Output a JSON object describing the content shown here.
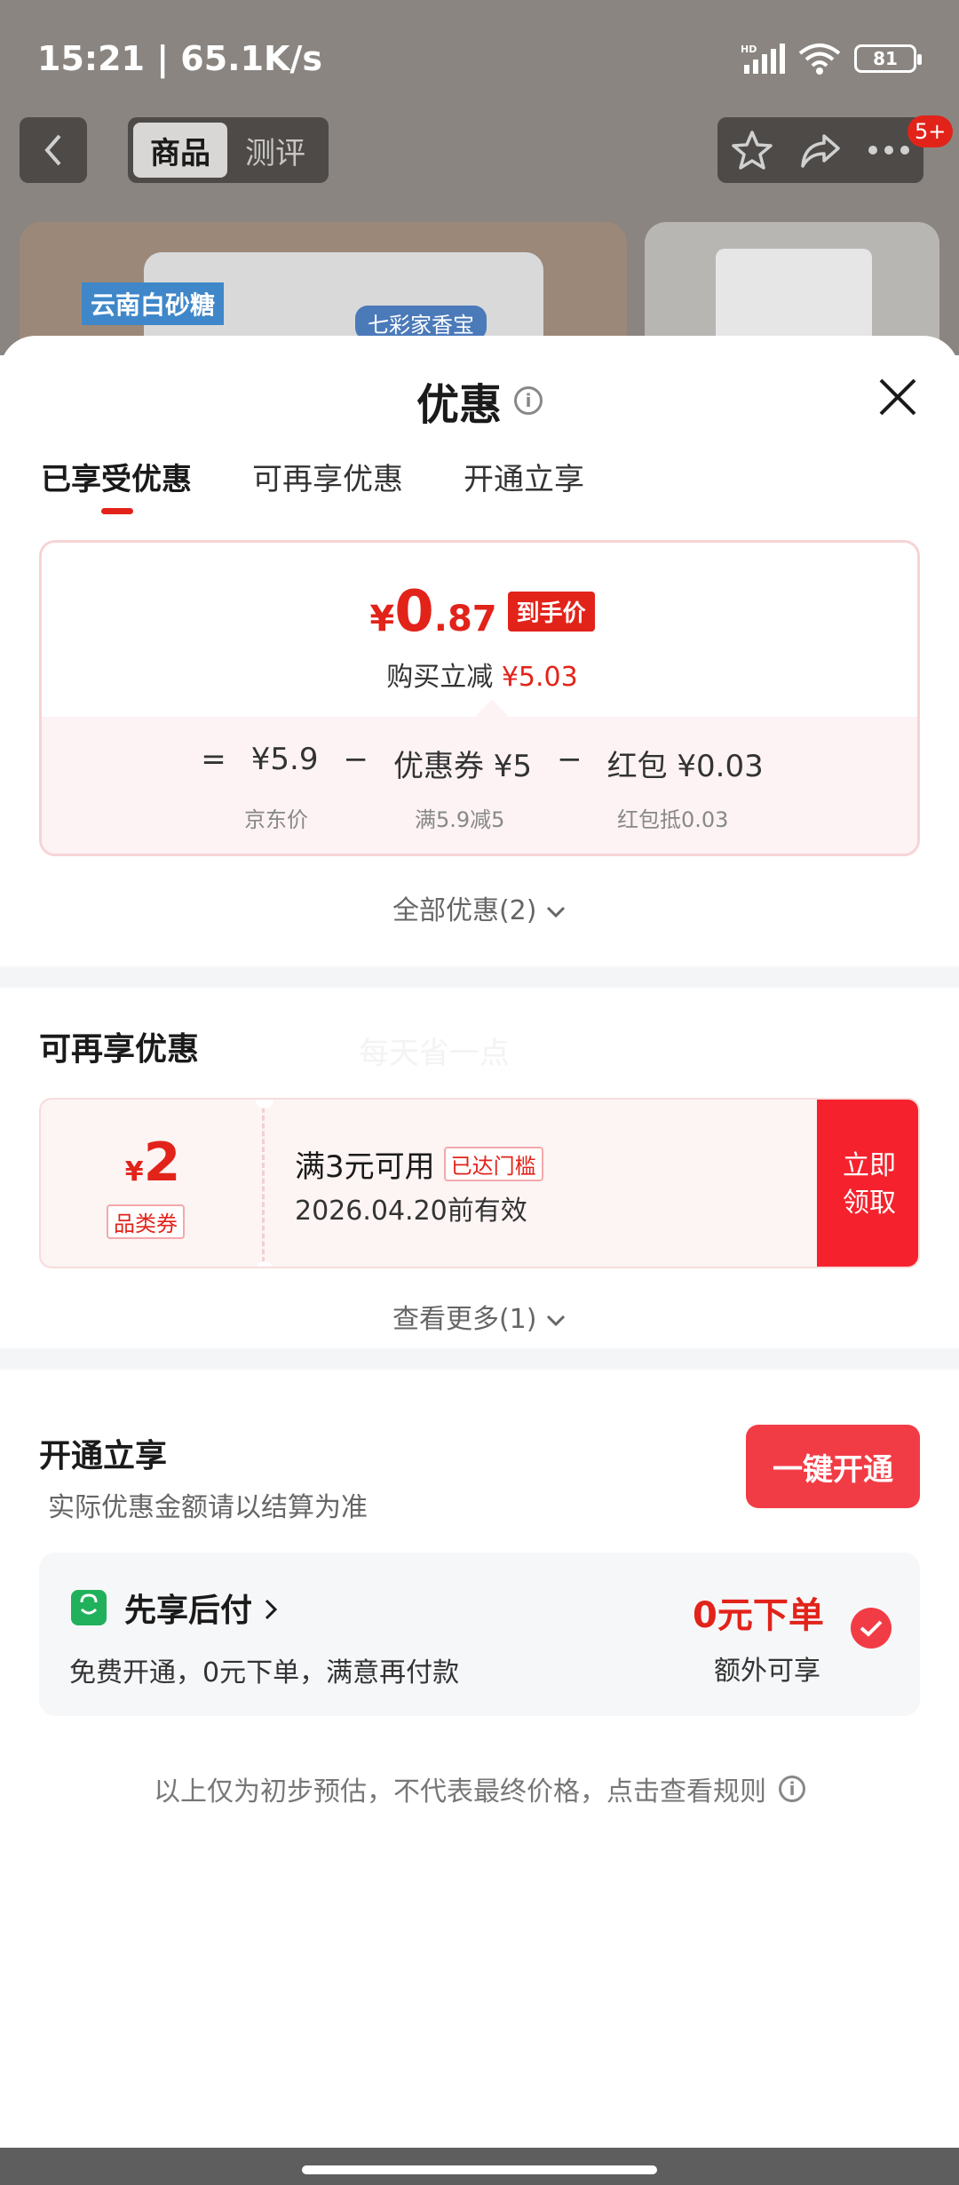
{
  "status_bar": {
    "time": "15:21 | 65.1K/s",
    "battery": "81",
    "hd_label": "HD"
  },
  "header": {
    "tabs": [
      "商品",
      "测评"
    ],
    "badge": "5+"
  },
  "background_products": {
    "brand_label": "七彩家香宝",
    "product2_label": "云南白砂糖"
  },
  "sheet": {
    "title": "优惠",
    "tabs": [
      "已享受优惠",
      "可再享优惠",
      "开通立享"
    ]
  },
  "summary": {
    "price_currency": "¥",
    "price_int": "0",
    "price_dec": ".87",
    "price_tag": "到手价",
    "reduce_label": "购买立减",
    "reduce_value": "¥5.03",
    "eq": "=",
    "jd_price": "¥5.9",
    "minus1": "−",
    "coupon_part": "优惠券 ¥5",
    "minus2": "−",
    "redpacket_part": "红包 ¥0.03",
    "jd_price_label": "京东价",
    "coupon_sub": "满5.9减5",
    "redpacket_sub": "红包抵0.03",
    "all_discounts": "全部优惠(2)"
  },
  "reenjoy": {
    "title": "可再享优惠",
    "watermark": "每天省一点",
    "coupon": {
      "currency": "¥",
      "amount": "2",
      "type": "品类券",
      "condition": "满3元可用",
      "reached": "已达门槛",
      "valid_until": "2026.04.20前有效",
      "button": "立即\n领取"
    },
    "more": "查看更多(1)"
  },
  "open": {
    "title": "开通立享",
    "subtitle": "实际优惠金额请以结算为准",
    "button": "一键开通",
    "pay_title": "先享后付",
    "pay_desc": "免费开通，0元下单，满意再付款",
    "pay_zero": "0元下单",
    "pay_extra": "额外可享"
  },
  "footer_note": "以上仅为初步预估，不代表最终价格，点击查看规则",
  "colors": {
    "accent": "#e2231a",
    "button_red": "#f23c45",
    "pay_green": "#21b15c"
  }
}
